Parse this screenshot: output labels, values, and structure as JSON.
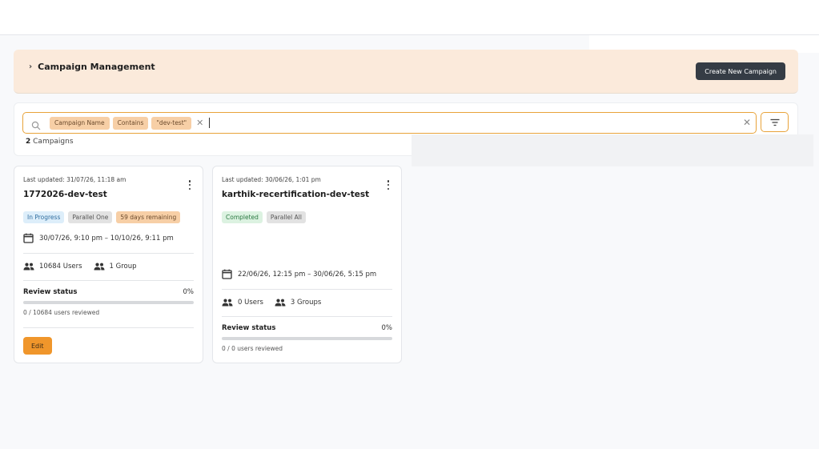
{
  "header": {
    "title": "Campaign Management",
    "create_button": "Create New Campaign"
  },
  "search": {
    "chips": [
      "Campaign Name",
      "Contains",
      "\"dev-test\""
    ],
    "placeholder": ""
  },
  "results": {
    "count": "2",
    "label": "Campaigns"
  },
  "cards": [
    {
      "updated": "Last updated: 31/07/26, 11:18 am",
      "name": "1772026-dev-test",
      "status": "In Progress",
      "mode": "Parallel One",
      "remaining": "59 days remaining",
      "dates": "30/07/26, 9:10 pm – 10/10/26, 9:11 pm",
      "users": "10684 Users",
      "groups": "1 Group",
      "review_label": "Review status",
      "review_pct": "0%",
      "review_value": 0,
      "reviewed": "0 / 10684 users reviewed",
      "edit_label": "Edit"
    },
    {
      "updated": "Last updated: 30/06/26, 1:01 pm",
      "name": "karthik-recertification-dev-test",
      "status": "Completed",
      "mode": "Parallel All",
      "dates": "22/06/26, 12:15 pm – 30/06/26, 5:15 pm",
      "users": "0 Users",
      "groups": "3 Groups",
      "review_label": "Review status",
      "review_pct": "0%",
      "review_value": 0,
      "reviewed": "0 / 0 users reviewed"
    }
  ],
  "colors": {
    "accent": "#e8a33a",
    "banner": "#fbeadb",
    "chip": "#f7cfa6",
    "primary_button": "#353c45"
  }
}
